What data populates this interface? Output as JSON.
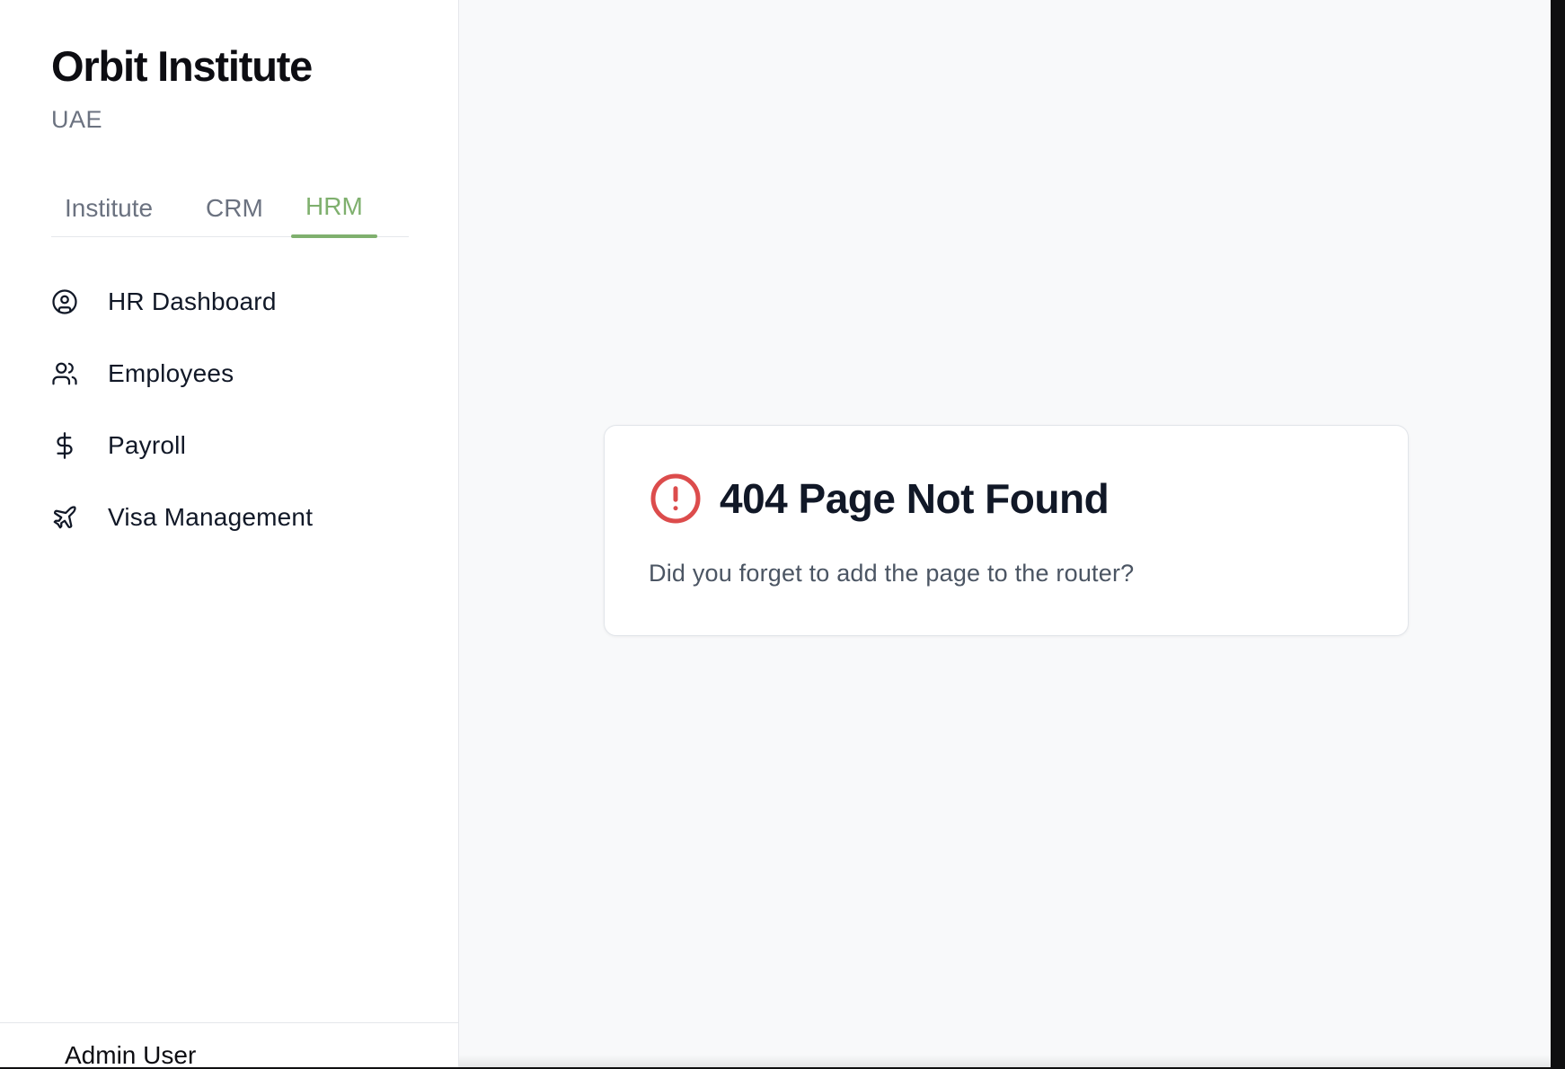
{
  "brand": {
    "title": "Orbit Institute",
    "subtitle": "UAE"
  },
  "tabs": [
    {
      "label": "Institute",
      "active": false
    },
    {
      "label": "CRM",
      "active": false
    },
    {
      "label": "HRM",
      "active": true
    }
  ],
  "nav": [
    {
      "label": "HR Dashboard",
      "icon": "user-circle-icon"
    },
    {
      "label": "Employees",
      "icon": "users-icon"
    },
    {
      "label": "Payroll",
      "icon": "dollar-icon"
    },
    {
      "label": "Visa Management",
      "icon": "plane-icon"
    }
  ],
  "footer": {
    "user": "Admin User"
  },
  "error": {
    "title": "404 Page Not Found",
    "message": "Did you forget to add the page to the router?",
    "icon": "alert-circle-icon"
  },
  "colors": {
    "accent": "#7fb06e",
    "error": "#dc4c4c",
    "text": "#111827",
    "muted": "#6b7280"
  }
}
